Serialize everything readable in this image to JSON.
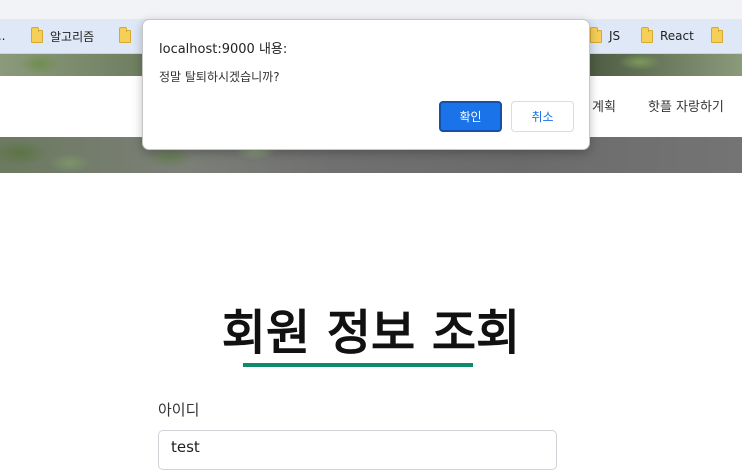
{
  "bookmarks": [
    {
      "label": "...",
      "icon": "folder-icon"
    },
    {
      "label": "알고리즘",
      "icon": "folder-icon"
    },
    {
      "label": "",
      "icon": "folder-icon"
    },
    {
      "label": "JS",
      "icon": "folder-icon"
    },
    {
      "label": "React",
      "icon": "folder-icon"
    },
    {
      "label": "",
      "icon": "folder-icon"
    }
  ],
  "nav": {
    "items": [
      "계획",
      "핫플 자랑하기"
    ]
  },
  "main": {
    "title": "회원 정보 조회",
    "id_label": "아이디",
    "id_value": "test",
    "accent_color": "#0f8a6a"
  },
  "dialog": {
    "title": "localhost:9000 내용:",
    "message": "정말 탈퇴하시겠습니까?",
    "ok_label": "확인",
    "cancel_label": "취소",
    "ok_color": "#1a73e8"
  }
}
